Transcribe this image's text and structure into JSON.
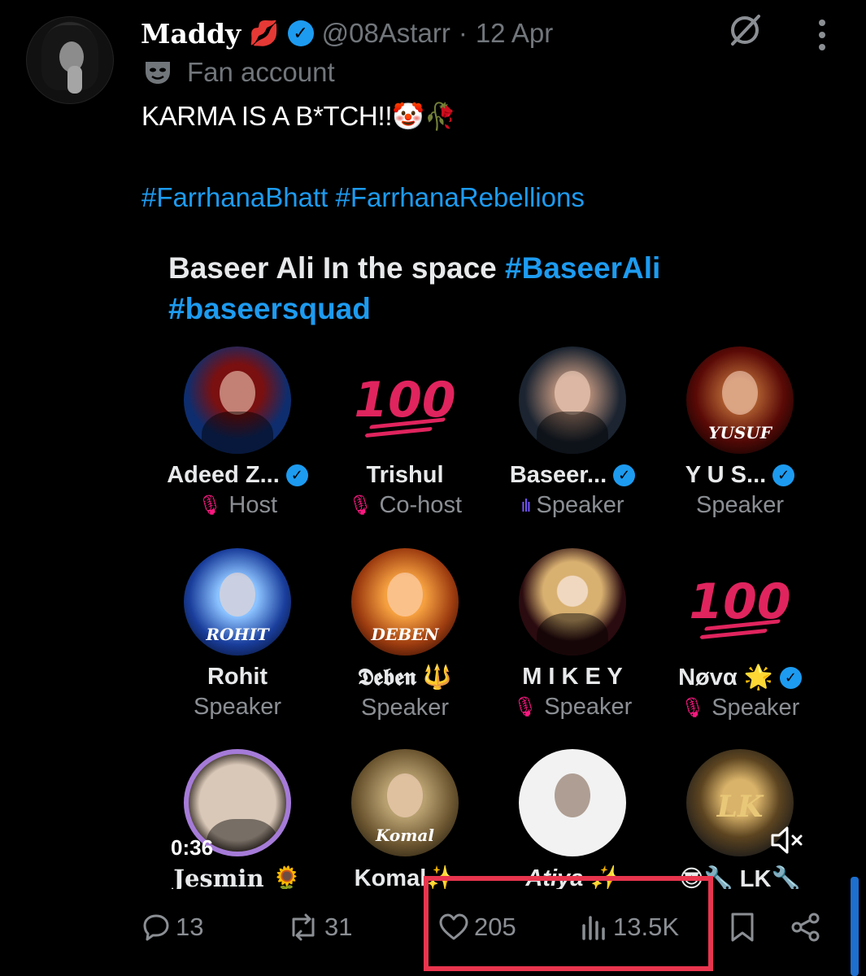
{
  "tweet": {
    "author_name": "Maddy",
    "author_emoji": "💋",
    "handle": "@08Astarr",
    "separator": "·",
    "date": "12 Apr",
    "label": "Fan account",
    "text": "KARMA IS A B*TCH!!",
    "text_emojis": "🤡🥀",
    "hashtags": "#FarrhanaBhatt #FarrhanaRebellions"
  },
  "media": {
    "title_text": "Baseer Ali In the space ",
    "title_tag1": "#BaseerAli",
    "title_tag2": "#baseersquad",
    "timestamp": "0:36",
    "mute_icon": "🔇",
    "participants": [
      {
        "name": "Adeed Z...",
        "role": "Host"
      },
      {
        "name": "Trishul",
        "role": "Co-host"
      },
      {
        "name": "Baseer...",
        "role": "Speaker"
      },
      {
        "name": "Y U S...",
        "role": "Speaker"
      },
      {
        "name": "Rohit",
        "role": "Speaker"
      },
      {
        "name": "𝕯𝖊𝖇𝖊𝖓 🔱",
        "role": "Speaker"
      },
      {
        "name": "M I K E Y",
        "role": "Speaker"
      },
      {
        "name": "Nøvα 🌟",
        "role": "Speaker"
      },
      {
        "name": "Jesmin 🌻"
      },
      {
        "name": "Komal✨"
      },
      {
        "name": "Atiya ✨"
      },
      {
        "name": "😎🔧 LK🔧"
      }
    ],
    "avatar_labels": {
      "yusuf": "YUSUF",
      "rohit": "ROHIT",
      "deben": "DEBEN",
      "komal": "Komal",
      "lk": "LK"
    },
    "hundred": "100"
  },
  "actions": {
    "replies": "13",
    "reposts": "31",
    "likes": "205",
    "views": "13.5K"
  },
  "colors": {
    "accent": "#1d9bf0",
    "highlight": "#e8354e",
    "muted": "#71767b"
  }
}
